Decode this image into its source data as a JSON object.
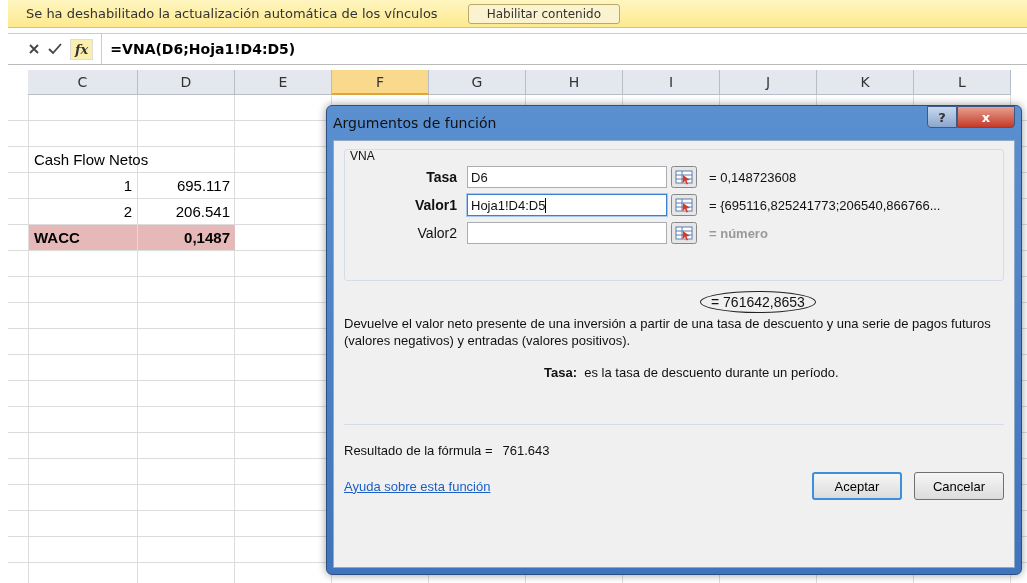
{
  "message_bar": {
    "text": "Se ha deshabilitado la actualización automática de los vínculos",
    "button": "Habilitar contenido"
  },
  "formula_bar": {
    "fx": "fx",
    "formula": "=VNA(D6;Hoja1!D4:D5)"
  },
  "columns": [
    {
      "label": "C",
      "selected": false
    },
    {
      "label": "D",
      "selected": false
    },
    {
      "label": "E",
      "selected": false
    },
    {
      "label": "F",
      "selected": true
    },
    {
      "label": "G",
      "selected": false
    },
    {
      "label": "H",
      "selected": false
    },
    {
      "label": "I",
      "selected": false
    },
    {
      "label": "J",
      "selected": false
    },
    {
      "label": "K",
      "selected": false
    },
    {
      "label": "L",
      "selected": false
    }
  ],
  "rows": [
    {
      "kind": "heading",
      "c": "Cash Flow Netos",
      "bold": false,
      "highlighted": false
    },
    {
      "kind": "number",
      "c": "1",
      "d": "695.117",
      "bold": false,
      "highlighted": false
    },
    {
      "kind": "number",
      "c": "2",
      "d": "206.541",
      "bold": false,
      "highlighted": false
    },
    {
      "kind": "label",
      "c": "WACC",
      "d": "0,1487",
      "bold": true,
      "highlighted": true
    }
  ],
  "dialog": {
    "title": "Argumentos de función",
    "help_button": "?",
    "close_button": "x",
    "function": "VNA",
    "arguments": [
      {
        "label": "Tasa",
        "required": true,
        "value": "D6",
        "focused": false,
        "result": "= 0,148723608",
        "result_muted": false
      },
      {
        "label": "Valor1",
        "required": true,
        "value": "Hoja1!D4:D5",
        "focused": true,
        "result": "= {695116,825241773;206540,866766...",
        "result_muted": false
      },
      {
        "label": "Valor2",
        "required": false,
        "focused": false,
        "result": "= número",
        "result_muted": true
      }
    ],
    "result": {
      "text": "=  761642,8653",
      "circled": true
    },
    "description": "Devuelve el valor neto presente de una inversión a partir de una tasa de descuento y una serie de pagos futuros (valores negativos) y entradas (valores positivos).",
    "arg_help": {
      "label": "Tasa:",
      "text": "es la tasa de descuento durante un período."
    },
    "formula_result_label": "Resultado de la fórmula =",
    "formula_result": "761.643",
    "help_link": "Ayuda sobre esta función",
    "buttons": [
      {
        "label": "Aceptar",
        "default": true
      },
      {
        "label": "Cancelar",
        "default": false
      }
    ]
  }
}
